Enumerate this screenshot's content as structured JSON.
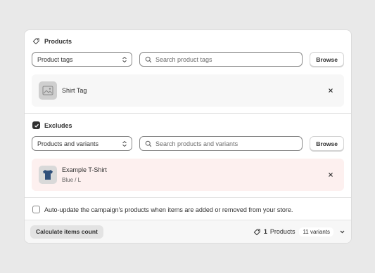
{
  "products": {
    "title": "Products",
    "select_value": "Product tags",
    "search_placeholder": "Search product tags",
    "browse_label": "Browse",
    "items": [
      {
        "title": "Shirt Tag"
      }
    ]
  },
  "excludes": {
    "label": "Excludes",
    "checked": true,
    "select_value": "Products and variants",
    "search_placeholder": "Search products and variants",
    "browse_label": "Browse",
    "items": [
      {
        "title": "Example T-Shirt",
        "subtitle": "Blue / L"
      }
    ]
  },
  "auto_update": {
    "label": "Auto-update the campaign's products when items are added or removed from your store.",
    "checked": false
  },
  "footer": {
    "calc_button": "Calculate items count",
    "count": "1",
    "count_label": "Products",
    "variants": "11 variants"
  },
  "colors": {
    "background": "#e9e9e9",
    "card": "#ffffff",
    "included_row": "#f7f7f7",
    "excluded_row": "#fdf0ef",
    "checkbox_checked": "#303030",
    "shirt_blue": "#2f4f7a"
  }
}
